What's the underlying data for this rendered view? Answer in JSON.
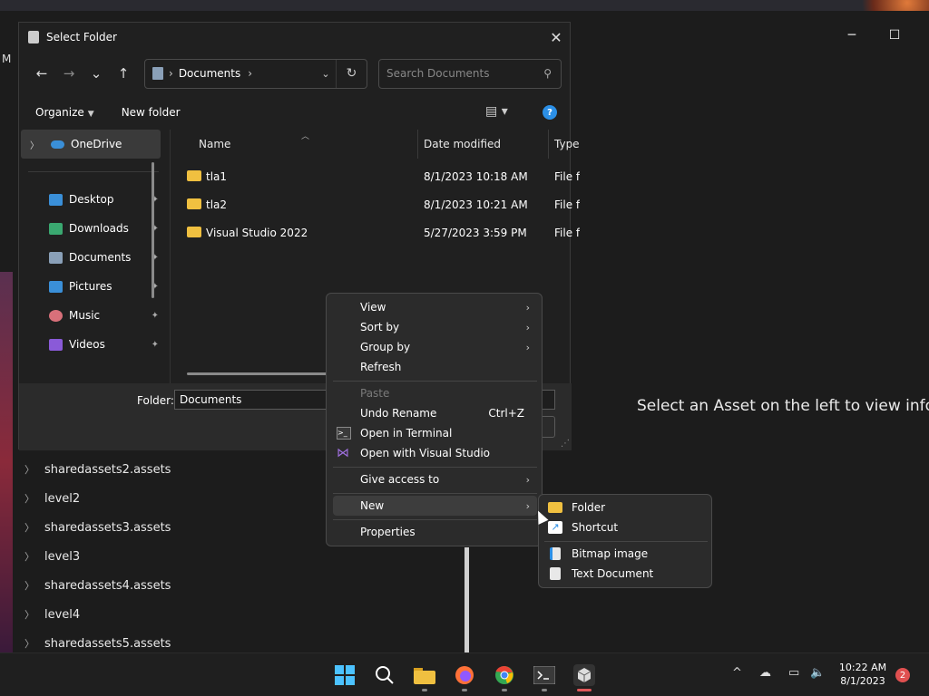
{
  "background_app": {
    "left_cut_text": "M",
    "minimize_icon": "─",
    "maximize_icon": "☐",
    "message": "Select an Asset on the left to view inform",
    "tree_items": [
      "sharedassets2.assets",
      "level2",
      "sharedassets3.assets",
      "level3",
      "sharedassets4.assets",
      "level4",
      "sharedassets5.assets"
    ]
  },
  "dialog": {
    "title": "Select Folder",
    "close_glyph": "✕",
    "nav": {
      "back": "←",
      "forward": "→",
      "recent": "⌄",
      "up": "↑"
    },
    "address": {
      "separator": "›",
      "path": "Documents",
      "trailing_separator": "›",
      "dropdown": "⌄",
      "refresh": "↻"
    },
    "search": {
      "placeholder": "Search Documents",
      "icon": "⚲"
    },
    "toolbar": {
      "organize": "Organize",
      "new_folder": "New folder",
      "view_icon": "▤",
      "view_caret": "▾",
      "help": "?"
    },
    "nav_pane": {
      "onedrive": "OneDrive",
      "quick_access": [
        {
          "label": "Desktop",
          "color": "#3a8fd8"
        },
        {
          "label": "Downloads",
          "color": "#3aa870"
        },
        {
          "label": "Documents",
          "color": "#8aa0b8"
        },
        {
          "label": "Pictures",
          "color": "#3a8fd8"
        },
        {
          "label": "Music",
          "color": "#d8707a"
        },
        {
          "label": "Videos",
          "color": "#8a5ad8"
        }
      ],
      "pin_glyph": "📌"
    },
    "columns": {
      "name": "Name",
      "date": "Date modified",
      "type": "Type"
    },
    "files": [
      {
        "name": "tla1",
        "date": "8/1/2023 10:18 AM",
        "type": "File fo"
      },
      {
        "name": "tla2",
        "date": "8/1/2023 10:21 AM",
        "type": "File fo"
      },
      {
        "name": "Visual Studio 2022",
        "date": "5/27/2023 3:59 PM",
        "type": "File fo"
      }
    ],
    "footer": {
      "folder_label": "Folder:",
      "folder_value": "Documents"
    }
  },
  "context_menu": {
    "view": "View",
    "sort_by": "Sort by",
    "group_by": "Group by",
    "refresh": "Refresh",
    "paste": "Paste",
    "undo_rename": "Undo Rename",
    "undo_shortcut": "Ctrl+Z",
    "open_terminal": "Open in Terminal",
    "open_vs": "Open with Visual Studio",
    "give_access": "Give access to",
    "new": "New",
    "properties": "Properties",
    "arrow": "›"
  },
  "submenu": {
    "folder": "Folder",
    "shortcut": "Shortcut",
    "bitmap": "Bitmap image",
    "text_doc": "Text Document"
  },
  "taskbar": {
    "time": "10:22 AM",
    "date": "8/1/2023",
    "notifications": "2",
    "tray_chevron": "^"
  },
  "colors": {
    "accent": "#2b8fe6",
    "folder": "#f0c040"
  }
}
